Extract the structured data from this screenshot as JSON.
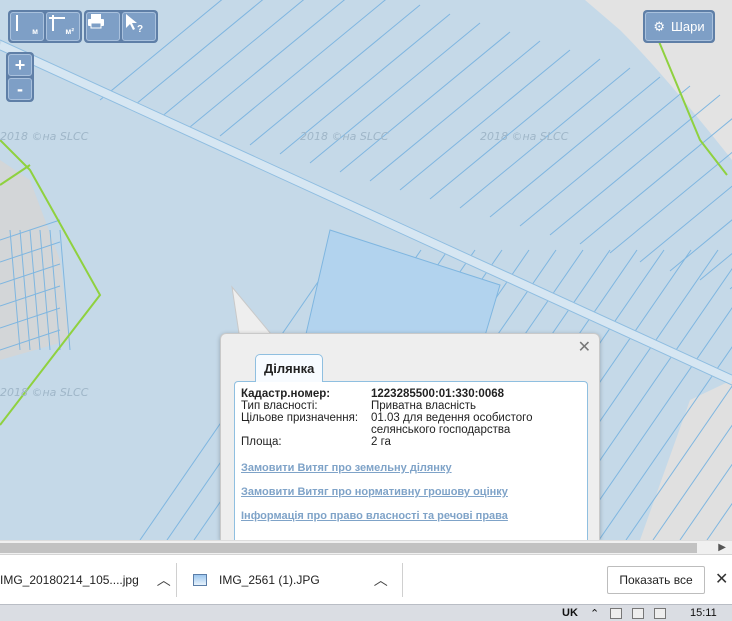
{
  "toolbar": {
    "measure_length_sub": "м",
    "measure_area_sub": "м²",
    "print_icon": "printer-icon",
    "identify_icon": "cursor-question-icon"
  },
  "zoom": {
    "in_label": "+",
    "out_label": "-"
  },
  "layers_button": {
    "label": "Шари",
    "icon": "gear-icon"
  },
  "watermarks": [
    "2018 ©на SLCC",
    "2018 ©на SLCC",
    "2018 ©на SLCC"
  ],
  "popup": {
    "tab_label": "Ділянка",
    "close_label": "✕",
    "fields": [
      {
        "label": "Кадастр.номер:",
        "value": "1223285500:01:330:0068"
      },
      {
        "label": "Тип власності:",
        "value": "Приватна власність"
      },
      {
        "label": "Цільове призначення:",
        "value": "01.03 для ведення особистого селянського господарства"
      },
      {
        "label": "Площа:",
        "value": "2 га"
      }
    ],
    "links": [
      "Замовити Витяг про земельну ділянку",
      "Замовити Витяг про нормативну грошову оцінку",
      "Інформація про право власності та речові права"
    ]
  },
  "downloads": {
    "items": [
      {
        "name": "IMG_20180214_105....jpg"
      },
      {
        "name": "IMG_2561 (1).JPG"
      }
    ],
    "show_all_label": "Показать все",
    "close_label": "✕"
  },
  "taskbar": {
    "language": "UK",
    "time": "15:11"
  },
  "colors": {
    "map_bg": "#c5d9e8",
    "parcel_line": "#7fb6e0",
    "highlight_parcel": "#b2d3ee",
    "boundary_green": "#8fd13f",
    "link_color": "#7fa3c8"
  }
}
